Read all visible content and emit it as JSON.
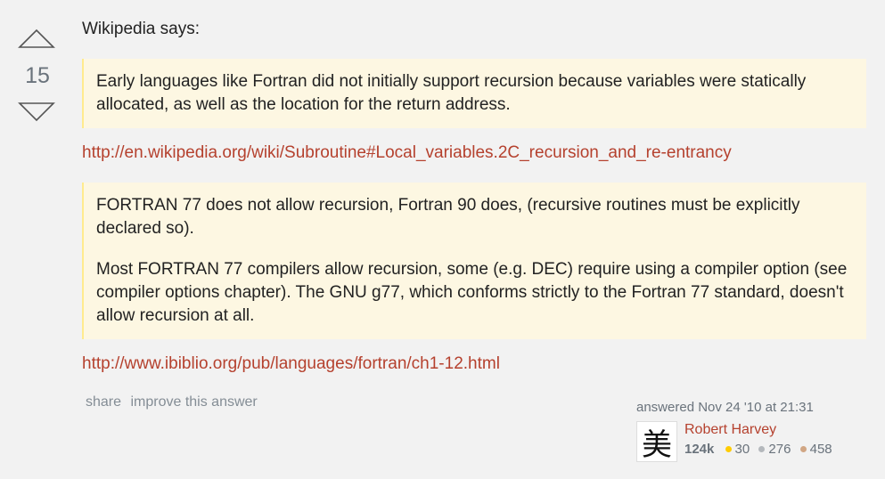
{
  "votes": {
    "count": "15",
    "upvote_icon": "triangle-up-icon",
    "downvote_icon": "triangle-down-icon"
  },
  "post": {
    "lead": "Wikipedia says:",
    "quote1": "Early languages like Fortran did not initially support recursion because variables were statically allocated, as well as the location for the return address.",
    "link1": "http://en.wikipedia.org/wiki/Subroutine#Local_variables.2C_recursion_and_re-entrancy",
    "quote2_p1": "FORTRAN 77 does not allow recursion, Fortran 90 does, (recursive routines must be explicitly declared so).",
    "quote2_p2": "Most FORTRAN 77 compilers allow recursion, some (e.g. DEC) require using a compiler option (see compiler options chapter). The GNU g77, which conforms strictly to the Fortran 77 standard, doesn't allow recursion at all.",
    "link2": "http://www.ibiblio.org/pub/languages/fortran/ch1-12.html"
  },
  "menu": {
    "share": "share",
    "improve": "improve this answer"
  },
  "user": {
    "answered": "answered Nov 24 '10 at 21:31",
    "avatar_glyph": "美",
    "name": "Robert Harvey",
    "reputation": "124k",
    "gold": "30",
    "silver": "276",
    "bronze": "458"
  },
  "colors": {
    "gold": "#ffcc01",
    "silver": "#b4b8bc",
    "bronze": "#d1a684",
    "link": "#b5412e",
    "quote_bg": "#fdf7e2"
  }
}
